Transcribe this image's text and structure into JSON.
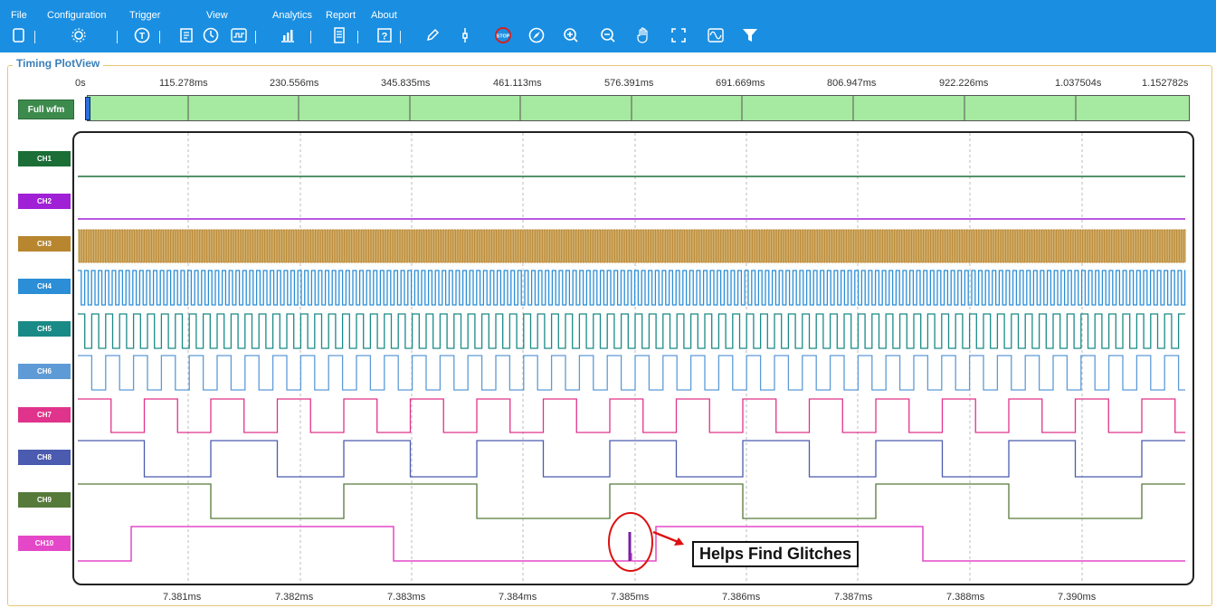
{
  "menu": [
    "File",
    "Configuration",
    "Trigger",
    "View",
    "Analytics",
    "Report",
    "About"
  ],
  "toolbar_icons": [
    "new-icon",
    "gear-icon",
    "trigger-icon",
    "timing-icon",
    "clock-icon",
    "waveform-icon",
    "analytics-chart-icon",
    "report-icon",
    "help-icon",
    "pencil-icon",
    "probe-icon",
    "stop-icon",
    "compass-icon",
    "zoom-in-icon",
    "zoom-out-icon",
    "hand-pan-icon",
    "fit-screen-icon",
    "wave-view-icon",
    "filter-icon"
  ],
  "panel": {
    "title": "Timing PlotView"
  },
  "full_wfm": {
    "label": "Full wfm",
    "marker_position": 0.0
  },
  "time_axis_top": [
    "0s",
    "115.278ms",
    "230.556ms",
    "345.835ms",
    "461.113ms",
    "576.391ms",
    "691.669ms",
    "806.947ms",
    "922.226ms",
    "1.037504s",
    "1.152782s"
  ],
  "time_axis_bottom": [
    "7.381ms",
    "7.382ms",
    "7.383ms",
    "7.384ms",
    "7.385ms",
    "7.386ms",
    "7.387ms",
    "7.388ms",
    "7.390ms"
  ],
  "channels": [
    {
      "label": "CH1",
      "color": "#1b6e36",
      "signal": "high"
    },
    {
      "label": "CH2",
      "color": "#a020d6",
      "signal": "high"
    },
    {
      "label": "CH3",
      "color": "#b8862f",
      "signal": "dense"
    },
    {
      "label": "CH4",
      "color": "#2b8ed6",
      "signal": "clock"
    },
    {
      "label": "CH5",
      "color": "#1a8a86",
      "signal": "clock"
    },
    {
      "label": "CH6",
      "color": "#5e9bd6",
      "signal": "clock"
    },
    {
      "label": "CH7",
      "color": "#e0338b",
      "signal": "clock"
    },
    {
      "label": "CH8",
      "color": "#4b5bb0",
      "signal": "clock"
    },
    {
      "label": "CH9",
      "color": "#567a3a",
      "signal": "clock"
    },
    {
      "label": "CH10",
      "color": "#e448c9",
      "signal": "clock-with-glitch"
    }
  ],
  "annotation": {
    "text": "Helps Find Glitches",
    "highlight_color": "#d11",
    "arrow_color": "#d11"
  }
}
